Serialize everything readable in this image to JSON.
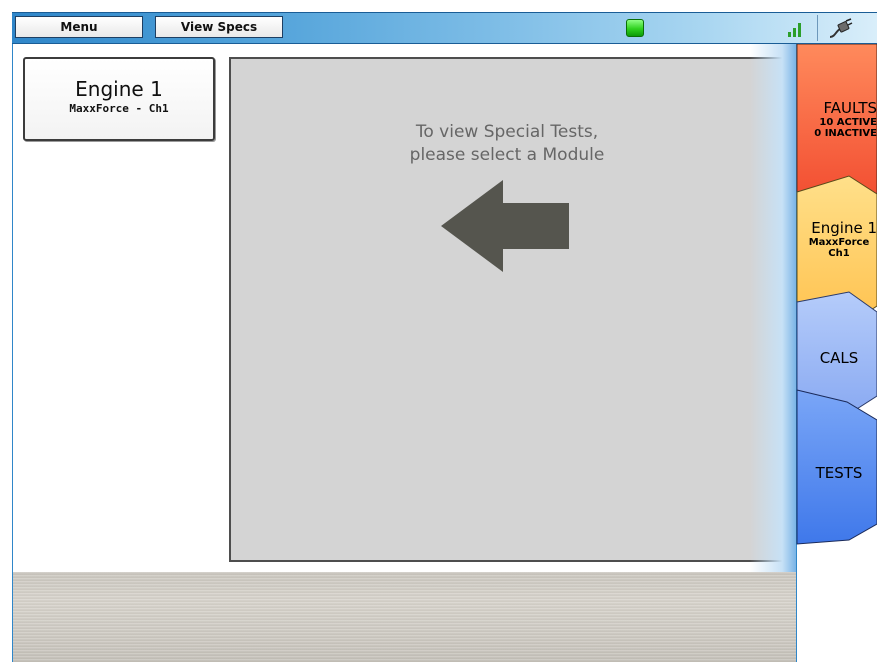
{
  "toolbar": {
    "menu_label": "Menu",
    "view_specs_label": "View Specs",
    "status_color": "#2fd11f",
    "signal_icon": "signal-bars-icon",
    "connection_icon": "cable-plug-icon"
  },
  "modules": [
    {
      "name": "Engine 1",
      "detail": "MaxxForce - Ch1"
    }
  ],
  "main": {
    "message": "To view Special Tests,\nplease select a Module",
    "arrow_icon": "arrow-left-icon"
  },
  "tabs": [
    {
      "id": "faults",
      "label": "FAULTS",
      "lines": [
        "10 ACTIVE",
        "0 INACTIVE"
      ],
      "color": "#ff6642"
    },
    {
      "id": "engine",
      "label": "Engine 1",
      "lines": [
        "MaxxForce",
        "Ch1"
      ],
      "color": "#ffcf66"
    },
    {
      "id": "cals",
      "label": "CALS",
      "lines": [],
      "color": "#9cbaf7"
    },
    {
      "id": "tests",
      "label": "TESTS",
      "lines": [],
      "color": "#5d8ff0",
      "selected": true
    }
  ]
}
